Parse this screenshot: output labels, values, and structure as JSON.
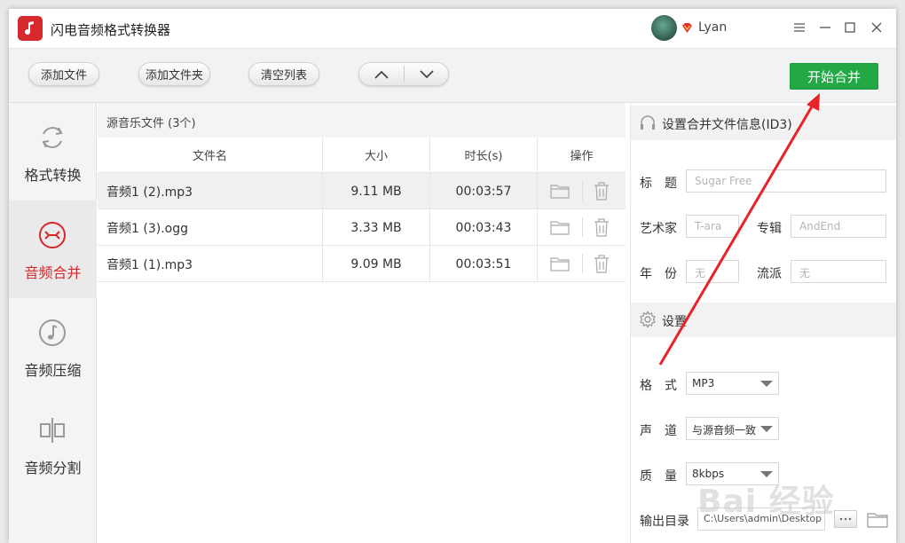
{
  "app": {
    "title": "闪电音频格式转换器",
    "user_name": "Lyan"
  },
  "colors": {
    "brand": "#d6282d",
    "start": "#23a846",
    "annotation_arrow": "#e8222a"
  },
  "toolbar": {
    "add_file": "添加文件",
    "add_folder": "添加文件夹",
    "clear_list": "清空列表",
    "start_merge": "开始合并"
  },
  "sidebar": {
    "items": [
      {
        "label": "格式转换",
        "icon": "refresh-icon",
        "active": false
      },
      {
        "label": "音频合并",
        "icon": "merge-icon",
        "active": true
      },
      {
        "label": "音频压缩",
        "icon": "music-note-icon",
        "active": false
      },
      {
        "label": "音频分割",
        "icon": "split-icon",
        "active": false
      }
    ]
  },
  "list": {
    "header": "源音乐文件 (3个)",
    "columns": [
      "文件名",
      "大小",
      "时长(s)",
      "操作"
    ],
    "rows": [
      {
        "name": "音频1 (2).mp3",
        "size": "9.11 MB",
        "duration": "00:03:57"
      },
      {
        "name": "音频1 (3).ogg",
        "size": "3.33 MB",
        "duration": "00:03:43"
      },
      {
        "name": "音频1 (1).mp3",
        "size": "9.09 MB",
        "duration": "00:03:51"
      }
    ]
  },
  "id3": {
    "section_title": "设置合并文件信息(ID3)",
    "title_label": "标　题",
    "title_placeholder": "Sugar Free",
    "artist_label": "艺术家",
    "artist_placeholder": "T-ara",
    "album_label": "专辑",
    "album_placeholder": "AndEnd",
    "year_label": "年　份",
    "year_placeholder": "无",
    "genre_label": "流派",
    "genre_placeholder": "无"
  },
  "settings": {
    "section_title": "设置",
    "format_label": "格　式",
    "format_value": "MP3",
    "channel_label": "声　道",
    "channel_value": "与源音频一致",
    "quality_label": "质　量",
    "quality_value": "8kbps",
    "output_label": "输出目录",
    "output_value": "C:\\Users\\admin\\Desktop"
  },
  "watermark": "Bai 经验"
}
